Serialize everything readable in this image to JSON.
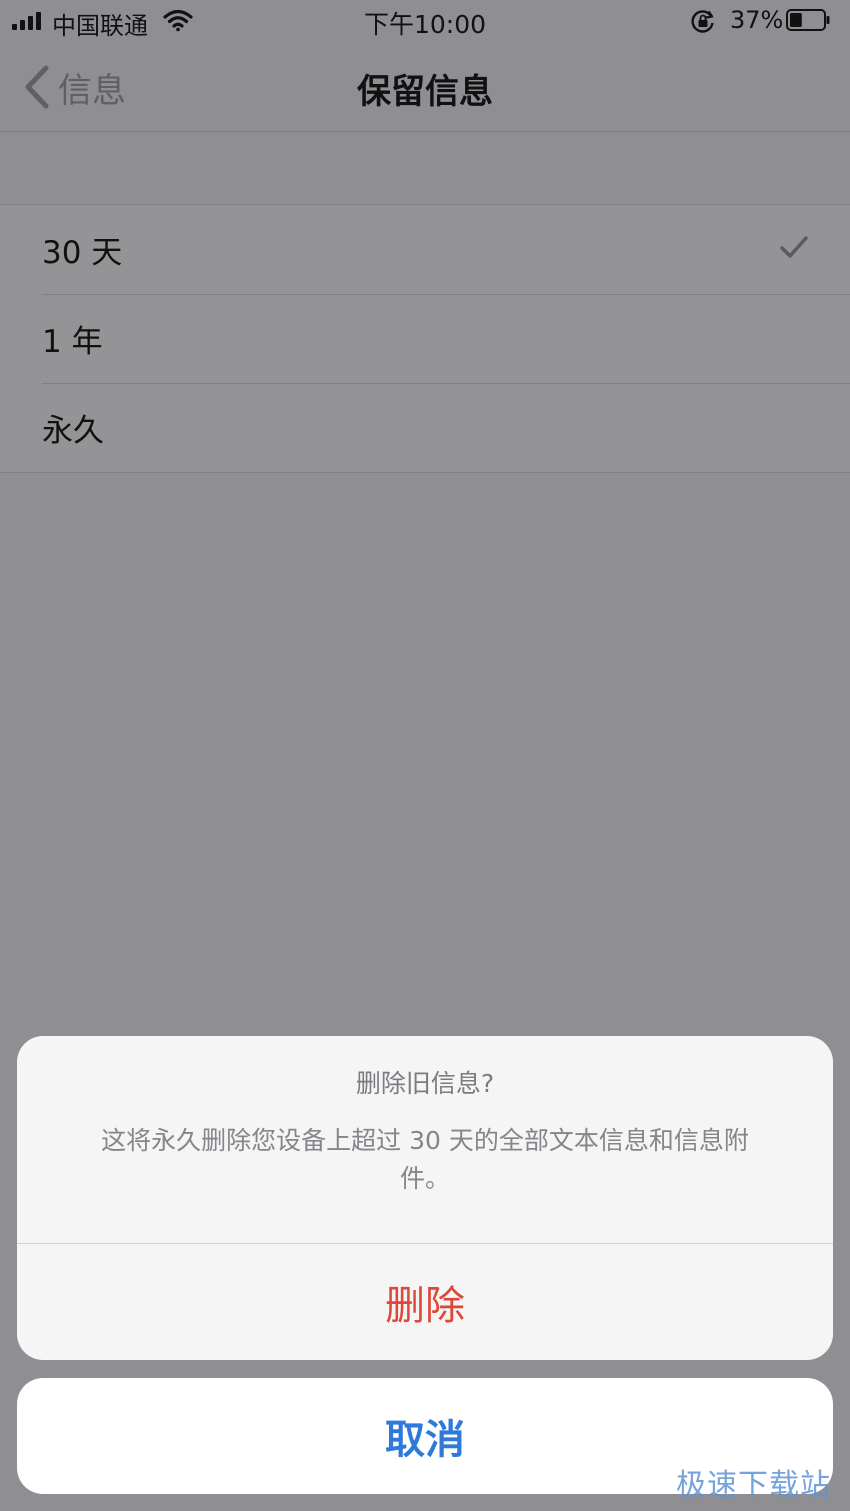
{
  "status_bar": {
    "carrier": "中国联通",
    "time": "下午10:00",
    "battery_percent": "37%",
    "battery_level": 0.37,
    "icons": [
      "signal-icon",
      "wifi-icon",
      "orientation-lock-icon",
      "battery-icon"
    ]
  },
  "nav": {
    "back_label": "信息",
    "title": "保留信息"
  },
  "options": [
    {
      "label": "30 天",
      "selected": true
    },
    {
      "label": "1 年",
      "selected": false
    },
    {
      "label": "永久",
      "selected": false
    }
  ],
  "action_sheet": {
    "title": "删除旧信息?",
    "message": "这将永久删除您设备上超过 30 天的全部文本信息和信息附件。",
    "delete_label": "删除",
    "cancel_label": "取消"
  },
  "colors": {
    "destructive": "#e0463a",
    "accent": "#2f7ad9"
  },
  "watermark": "极速下载站"
}
